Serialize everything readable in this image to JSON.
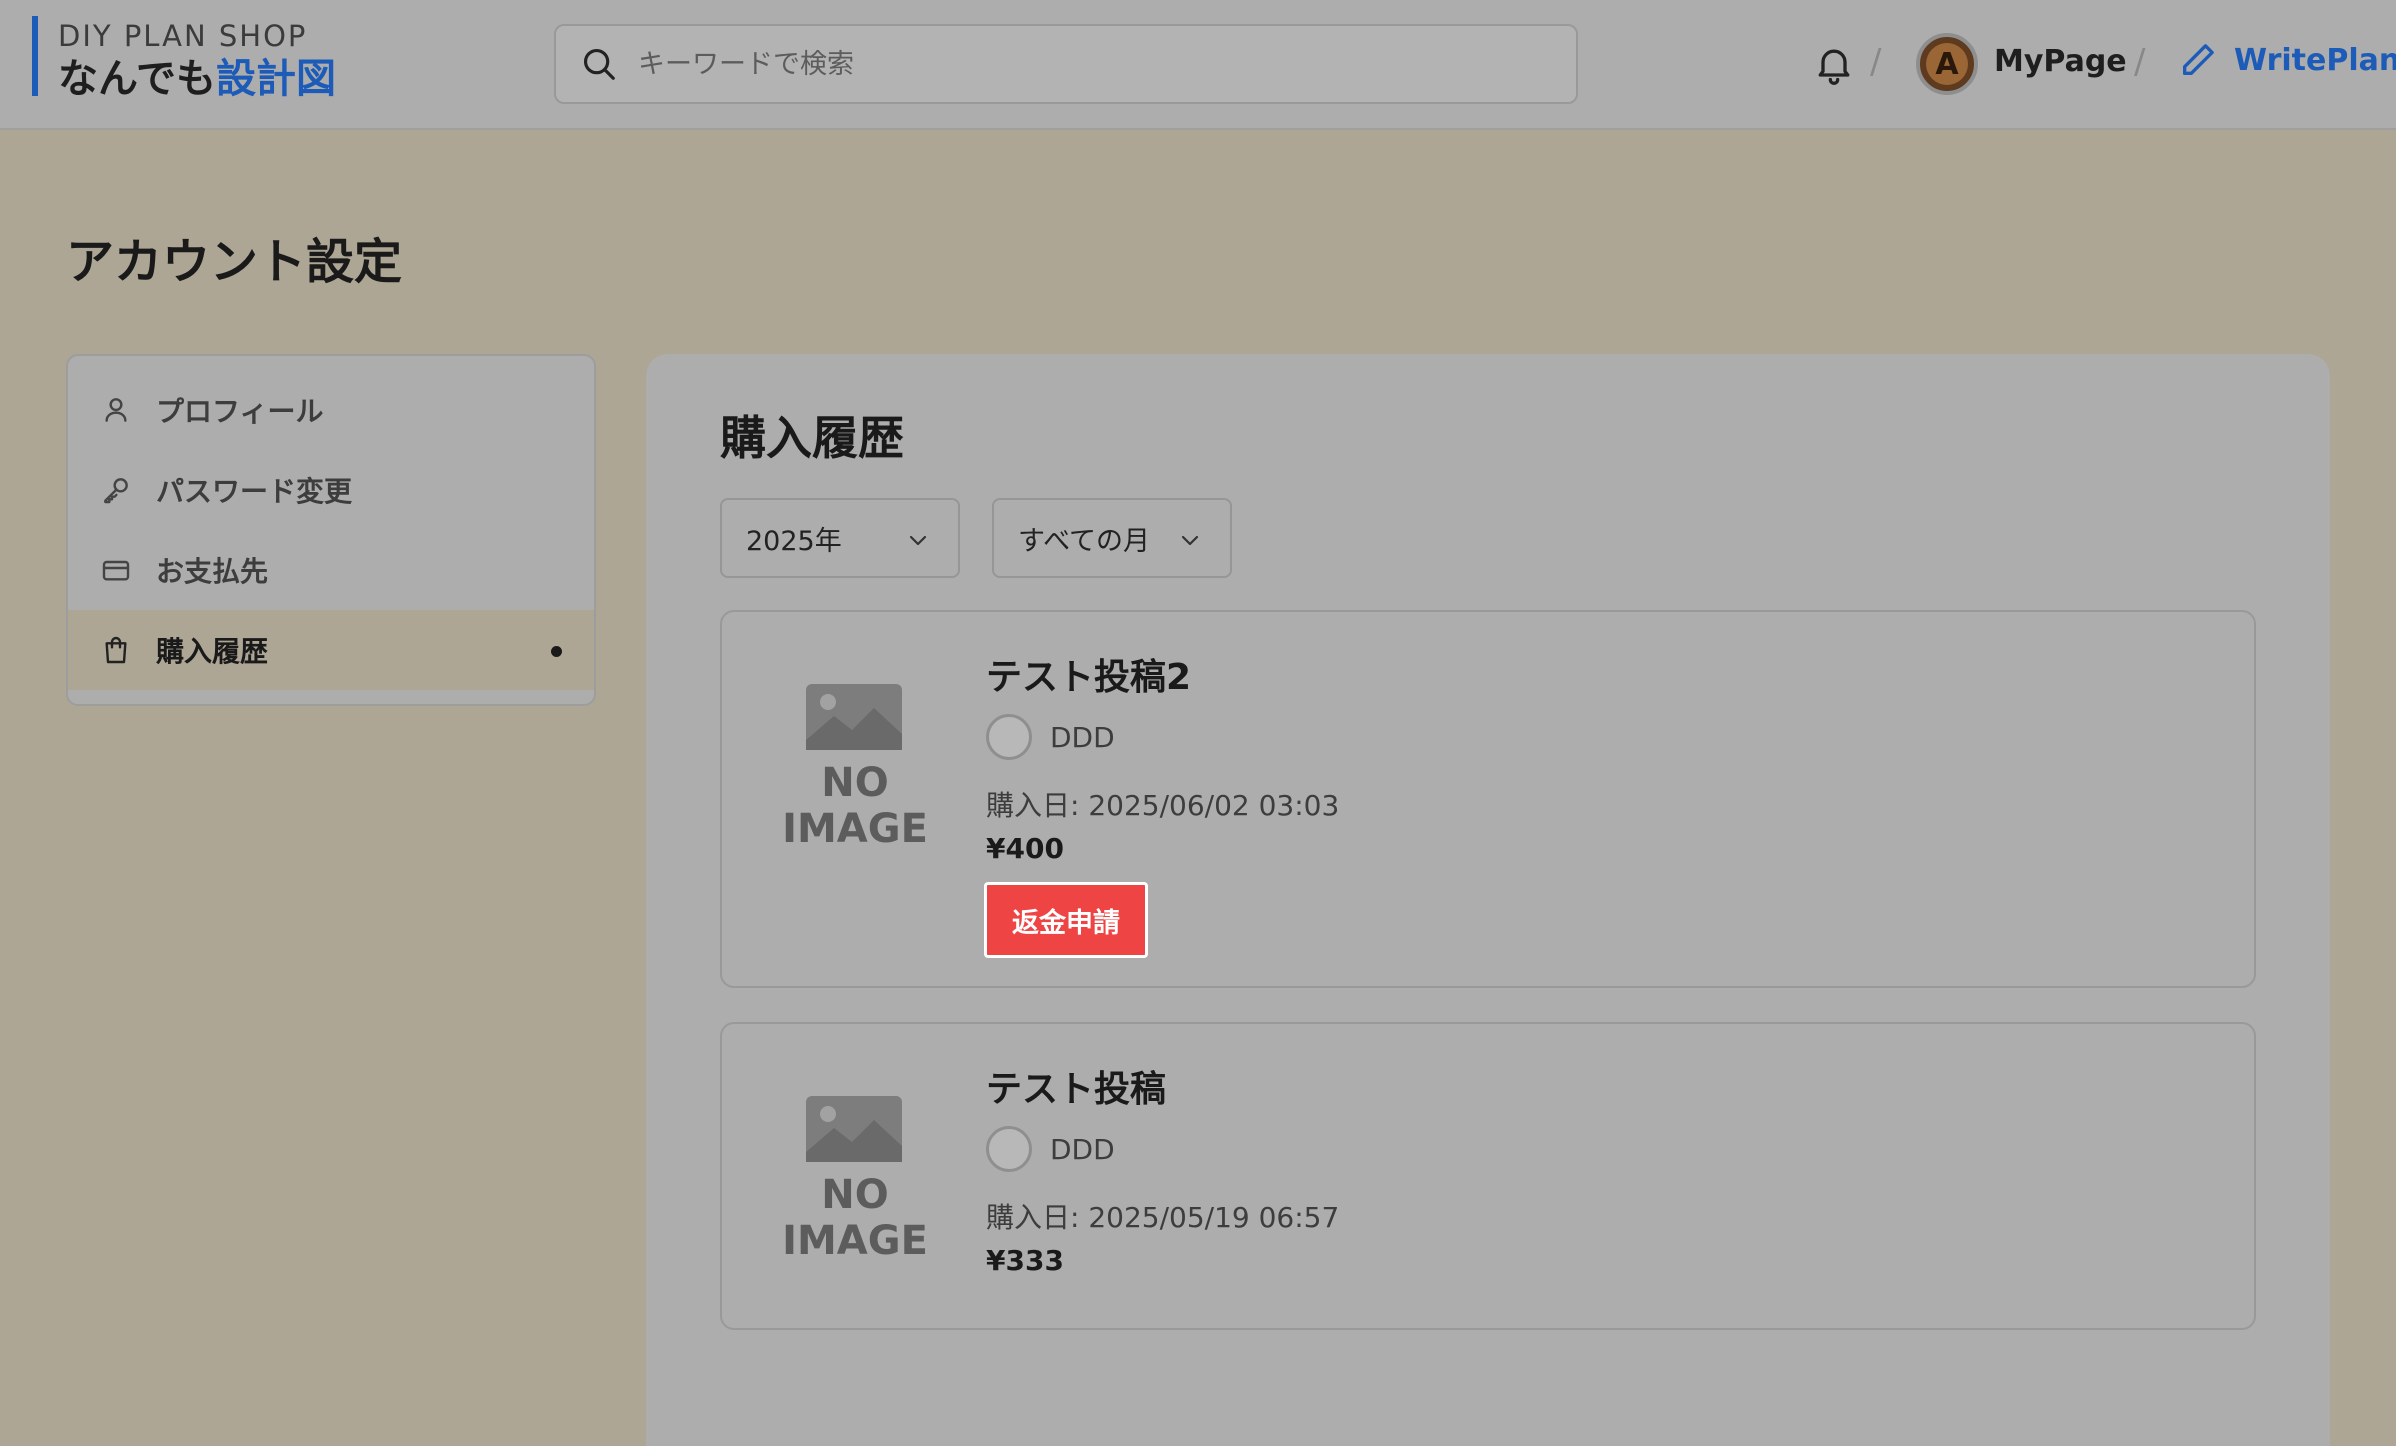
{
  "header": {
    "logo_top": "DIY PLAN SHOP",
    "logo_main": "なんでも",
    "logo_accent": "設計図",
    "search_placeholder": "キーワードで検索",
    "separator": "/",
    "mypage_label": "MyPage",
    "writeplan_label": "WritePlan"
  },
  "page": {
    "title": "アカウント設定"
  },
  "sidebar": {
    "items": [
      {
        "label": "プロフィール",
        "icon": "user-icon"
      },
      {
        "label": "パスワード変更",
        "icon": "key-icon"
      },
      {
        "label": "お支払先",
        "icon": "credit-card-icon"
      },
      {
        "label": "購入履歴",
        "icon": "shopping-bag-icon",
        "active": true
      }
    ]
  },
  "main": {
    "title": "購入履歴",
    "year_select": "2025年",
    "month_select": "すべての月",
    "purchases": [
      {
        "image_text": "NO IMAGE",
        "title": "テスト投稿2",
        "author": "DDD",
        "date": "購入日: 2025/06/02 03:03",
        "price": "¥400",
        "refund_label": "返金申請"
      },
      {
        "image_text": "NO IMAGE",
        "title": "テスト投稿",
        "author": "DDD",
        "date": "購入日: 2025/05/19 06:57",
        "price": "¥333"
      }
    ]
  },
  "colors": {
    "accent": "#1c5bb7",
    "refund": "#ef4444",
    "backdrop": "#aea695"
  }
}
